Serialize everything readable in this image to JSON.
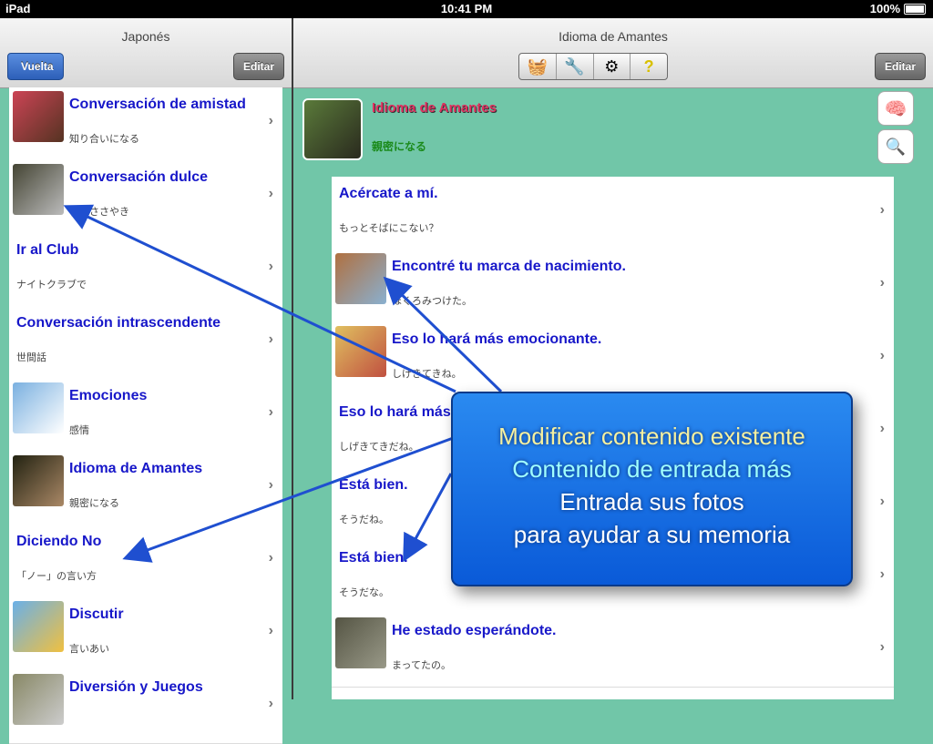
{
  "status": {
    "device": "iPad",
    "time": "10:41 PM",
    "battery": "100%"
  },
  "left": {
    "title": "Japonés",
    "back": "Vuelta",
    "edit": "Editar",
    "rows": [
      {
        "title": "Conversación de amistad",
        "sub": "知り合いになる"
      },
      {
        "title": "Conversación dulce",
        "sub": "甘いささやき"
      },
      {
        "title": "Ir al Club",
        "sub": "ナイトクラブで"
      },
      {
        "title": "Conversación intrascendente",
        "sub": "世間話"
      },
      {
        "title": "Emociones",
        "sub": "感情"
      },
      {
        "title": "Idioma de Amantes",
        "sub": "親密になる"
      },
      {
        "title": "Diciendo No",
        "sub": "「ノー」の言い方"
      },
      {
        "title": "Discutir",
        "sub": "言いあい"
      },
      {
        "title": "Diversión y Juegos",
        "sub": ""
      }
    ]
  },
  "right": {
    "title": "Idioma de Amantes",
    "edit": "Editar",
    "header_title": "Idioma de Amantes",
    "header_sub": "親密になる",
    "rows": [
      {
        "title": "Acércate a mí.",
        "sub": "もっとそばにこない？"
      },
      {
        "title": "Encontré tu marca de nacimiento.",
        "sub": "ほくろみつけた。"
      },
      {
        "title": "Eso lo hará más emocionante.",
        "sub": "しげきてきね。"
      },
      {
        "title": "Eso lo hará más",
        "sub": "しげきてきだね。"
      },
      {
        "title": "Está bien.",
        "sub": "そうだね。"
      },
      {
        "title": "Está bien.",
        "sub": "そうだな。"
      },
      {
        "title": "He estado esperándote.",
        "sub": "まってたの。"
      }
    ]
  },
  "callout": {
    "line1": "Modificar contenido existente",
    "line2": "Contenido de entrada más",
    "line3": "Entrada sus fotos",
    "line4": "para ayudar a su memoria"
  },
  "icons": {
    "basket": "basket-icon",
    "tools": "tools-icon",
    "gears": "gears-icon",
    "help": "help-icon",
    "brain": "brain-icon",
    "search": "search-icon"
  }
}
